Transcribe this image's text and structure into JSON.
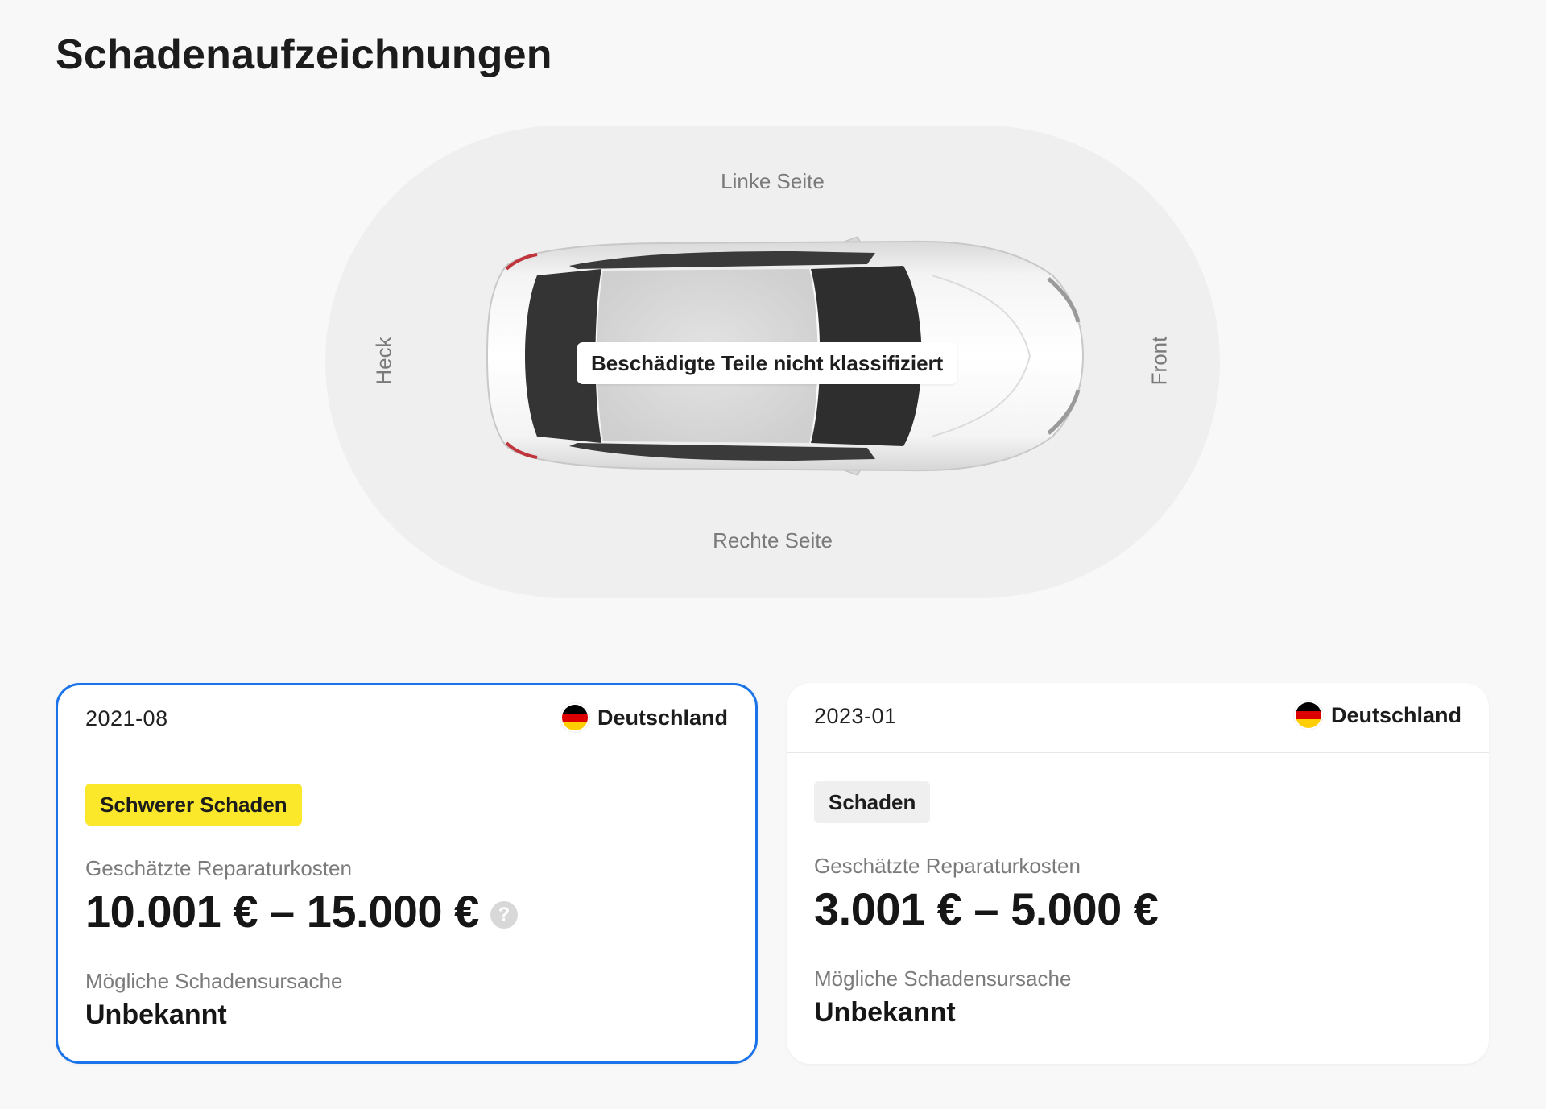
{
  "page": {
    "title": "Schadenaufzeichnungen"
  },
  "diagram": {
    "label_left": "Linke Seite",
    "label_right": "Rechte Seite",
    "label_rear": "Heck",
    "label_front": "Front",
    "status_tag": "Beschädigte Teile nicht klassifiziert"
  },
  "records": [
    {
      "date": "2021-08",
      "country": "Deutschland",
      "flag": "germany-flag-icon",
      "severity": "Schwerer Schaden",
      "severity_color": "#fce82a",
      "cost_label": "Geschätzte Reparaturkosten",
      "cost_value": "10.001 € – 15.000 €",
      "cause_label": "Mögliche Schadensursache",
      "cause_value": "Unbekannt",
      "selected": true
    },
    {
      "date": "2023-01",
      "country": "Deutschland",
      "flag": "germany-flag-icon",
      "severity": "Schaden",
      "severity_color": "#efefef",
      "cost_label": "Geschätzte Reparaturkosten",
      "cost_value": "3.001 € – 5.000 €",
      "cause_label": "Mögliche Schadensursache",
      "cause_value": "Unbekannt",
      "selected": false
    }
  ],
  "colors": {
    "selected_border": "#1a73e8",
    "flag": [
      "#000000",
      "#dd0000",
      "#ffce00"
    ]
  }
}
